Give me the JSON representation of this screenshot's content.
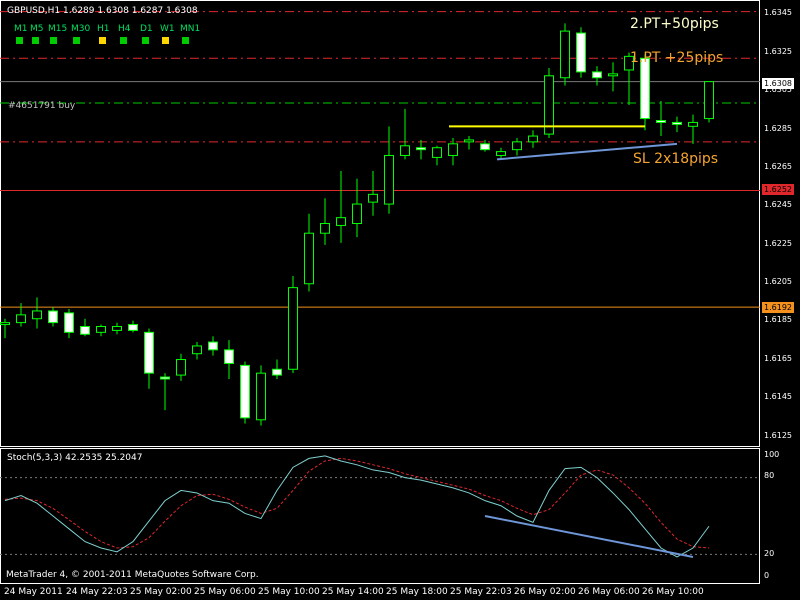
{
  "header": {
    "title": "GBPUSD,H1  1.6289 1.6308 1.6287 1.6308"
  },
  "timeframes": [
    {
      "label": "M1",
      "color": "#00cc00"
    },
    {
      "label": "M5",
      "color": "#00cc00"
    },
    {
      "label": "M15",
      "color": "#00cc00"
    },
    {
      "label": "M30",
      "color": "#00cc00"
    },
    {
      "label": "H1",
      "color": "#ffd700"
    },
    {
      "label": "H4",
      "color": "#00cc00"
    },
    {
      "label": "D1",
      "color": "#00cc00"
    },
    {
      "label": "W1",
      "color": "#ffd700"
    },
    {
      "label": "MN1",
      "color": "#00cc00"
    }
  ],
  "order": {
    "label": "#4651791 buy"
  },
  "annotations": {
    "pt2": "2.PT+50pips",
    "pt1": "1.PT +25pips",
    "sl": "SL 2x18pips"
  },
  "price_axis": {
    "ticks": [
      "1.6345",
      "1.6325",
      "1.6305",
      "1.6285",
      "1.6265",
      "1.6245",
      "1.6225",
      "1.6205",
      "1.6185",
      "1.6165",
      "1.6145",
      "1.6125"
    ],
    "current_price": "1.6308",
    "red_level": "1.6252",
    "orange_level": "1.6192"
  },
  "stochastic": {
    "label": "Stoch(5,3,3) 42.2535 25.2047",
    "levels": [
      "100",
      "80",
      "20",
      "0"
    ]
  },
  "footer": {
    "copyright": "MetaTrader 4, © 2001-2011 MetaQuotes Software Corp."
  },
  "time_axis": [
    "24 May 2011",
    "24 May 22:03",
    "25 May 02:00",
    "25 May 06:00",
    "25 May 10:00",
    "25 May 14:00",
    "25 May 18:00",
    "25 May 22:03",
    "26 May 02:00",
    "26 May 06:00",
    "26 May 10:00"
  ],
  "chart_data": {
    "type": "candlestick",
    "symbol": "GBPUSD",
    "timeframe": "H1",
    "ylim": [
      1.612,
      1.635
    ],
    "candles": [
      {
        "o": 1.6183,
        "h": 1.6186,
        "l": 1.6176,
        "c": 1.6184
      },
      {
        "o": 1.6184,
        "h": 1.6194,
        "l": 1.6182,
        "c": 1.6188
      },
      {
        "o": 1.6186,
        "h": 1.6197,
        "l": 1.6181,
        "c": 1.619
      },
      {
        "o": 1.619,
        "h": 1.6192,
        "l": 1.6182,
        "c": 1.6184
      },
      {
        "o": 1.6189,
        "h": 1.6191,
        "l": 1.6176,
        "c": 1.6179
      },
      {
        "o": 1.6182,
        "h": 1.6186,
        "l": 1.6177,
        "c": 1.6178
      },
      {
        "o": 1.6179,
        "h": 1.6183,
        "l": 1.6177,
        "c": 1.6182
      },
      {
        "o": 1.618,
        "h": 1.6184,
        "l": 1.6178,
        "c": 1.6182
      },
      {
        "o": 1.6183,
        "h": 1.6185,
        "l": 1.6179,
        "c": 1.618
      },
      {
        "o": 1.6179,
        "h": 1.6181,
        "l": 1.615,
        "c": 1.6158
      },
      {
        "o": 1.6156,
        "h": 1.6158,
        "l": 1.6139,
        "c": 1.6155
      },
      {
        "o": 1.6157,
        "h": 1.6168,
        "l": 1.6154,
        "c": 1.6165
      },
      {
        "o": 1.6168,
        "h": 1.6174,
        "l": 1.6165,
        "c": 1.6172
      },
      {
        "o": 1.6174,
        "h": 1.6177,
        "l": 1.6167,
        "c": 1.617
      },
      {
        "o": 1.617,
        "h": 1.6175,
        "l": 1.6155,
        "c": 1.6163
      },
      {
        "o": 1.6162,
        "h": 1.6164,
        "l": 1.6132,
        "c": 1.6135
      },
      {
        "o": 1.6134,
        "h": 1.6162,
        "l": 1.6131,
        "c": 1.6158
      },
      {
        "o": 1.616,
        "h": 1.6165,
        "l": 1.6155,
        "c": 1.6157
      },
      {
        "o": 1.616,
        "h": 1.6208,
        "l": 1.6158,
        "c": 1.6202
      },
      {
        "o": 1.6204,
        "h": 1.624,
        "l": 1.62,
        "c": 1.623
      },
      {
        "o": 1.623,
        "h": 1.6248,
        "l": 1.6224,
        "c": 1.6235
      },
      {
        "o": 1.6234,
        "h": 1.6262,
        "l": 1.6225,
        "c": 1.6238
      },
      {
        "o": 1.6235,
        "h": 1.6258,
        "l": 1.6228,
        "c": 1.6245
      },
      {
        "o": 1.6246,
        "h": 1.6262,
        "l": 1.6239,
        "c": 1.625
      },
      {
        "o": 1.6245,
        "h": 1.6285,
        "l": 1.624,
        "c": 1.627
      },
      {
        "o": 1.627,
        "h": 1.6294,
        "l": 1.6268,
        "c": 1.6275
      },
      {
        "o": 1.6274,
        "h": 1.6278,
        "l": 1.6268,
        "c": 1.6273
      },
      {
        "o": 1.6269,
        "h": 1.6275,
        "l": 1.6265,
        "c": 1.6274
      },
      {
        "o": 1.627,
        "h": 1.6279,
        "l": 1.6265,
        "c": 1.6276
      },
      {
        "o": 1.6277,
        "h": 1.628,
        "l": 1.6273,
        "c": 1.6278
      },
      {
        "o": 1.6276,
        "h": 1.6278,
        "l": 1.6272,
        "c": 1.6273
      },
      {
        "o": 1.627,
        "h": 1.6274,
        "l": 1.6268,
        "c": 1.6272
      },
      {
        "o": 1.6273,
        "h": 1.6279,
        "l": 1.627,
        "c": 1.6277
      },
      {
        "o": 1.6277,
        "h": 1.6283,
        "l": 1.6274,
        "c": 1.628
      },
      {
        "o": 1.6281,
        "h": 1.6315,
        "l": 1.6279,
        "c": 1.6311
      },
      {
        "o": 1.631,
        "h": 1.6338,
        "l": 1.6306,
        "c": 1.6334
      },
      {
        "o": 1.6333,
        "h": 1.6336,
        "l": 1.631,
        "c": 1.6313
      },
      {
        "o": 1.6313,
        "h": 1.6316,
        "l": 1.6306,
        "c": 1.631
      },
      {
        "o": 1.6311,
        "h": 1.6318,
        "l": 1.6303,
        "c": 1.6312
      },
      {
        "o": 1.6314,
        "h": 1.6323,
        "l": 1.6296,
        "c": 1.6321
      },
      {
        "o": 1.632,
        "h": 1.6322,
        "l": 1.6283,
        "c": 1.6289
      },
      {
        "o": 1.6288,
        "h": 1.6298,
        "l": 1.628,
        "c": 1.6287
      },
      {
        "o": 1.6287,
        "h": 1.629,
        "l": 1.6282,
        "c": 1.6286
      },
      {
        "o": 1.6285,
        "h": 1.6291,
        "l": 1.6276,
        "c": 1.6287
      },
      {
        "o": 1.6289,
        "h": 1.6308,
        "l": 1.6287,
        "c": 1.6308
      }
    ],
    "hlines": [
      {
        "price": 1.6344,
        "color": "#e0282c",
        "dash": true
      },
      {
        "price": 1.632,
        "color": "#e0282c",
        "dash": true
      },
      {
        "price": 1.6308,
        "color": "#7a7a7a",
        "dash": false
      },
      {
        "price": 1.6297,
        "color": "#00cc00",
        "dash": true
      },
      {
        "price": 1.6277,
        "color": "#e0282c",
        "dash": true
      },
      {
        "price": 1.6252,
        "color": "#e0282c",
        "dash": false
      },
      {
        "price": 1.6192,
        "color": "#f4901e",
        "dash": false
      }
    ],
    "trendlines": [
      {
        "from": [
          28,
          1.6285
        ],
        "to": [
          40,
          1.6285
        ],
        "color": "#ffff00"
      },
      {
        "from": [
          31,
          1.6268
        ],
        "to": [
          42,
          1.6276
        ],
        "color": "#6e96d8"
      }
    ],
    "stoch_main": [
      62,
      66,
      60,
      50,
      40,
      30,
      25,
      22,
      30,
      46,
      62,
      70,
      68,
      62,
      60,
      52,
      48,
      70,
      88,
      95,
      97,
      93,
      90,
      86,
      84,
      80,
      78,
      75,
      72,
      68,
      62,
      58,
      50,
      45,
      70,
      87,
      88,
      80,
      68,
      55,
      40,
      25,
      18,
      25,
      42
    ],
    "stoch_signal": [
      63,
      64,
      62,
      56,
      47,
      38,
      30,
      25,
      26,
      33,
      46,
      58,
      66,
      67,
      63,
      57,
      52,
      56,
      70,
      85,
      93,
      95,
      93,
      90,
      87,
      83,
      80,
      77,
      74,
      71,
      66,
      62,
      56,
      51,
      55,
      68,
      82,
      86,
      82,
      72,
      60,
      45,
      32,
      26,
      25
    ]
  }
}
